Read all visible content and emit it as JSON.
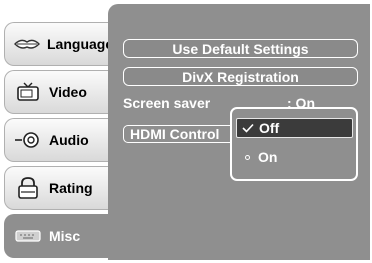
{
  "sidebar": {
    "tabs": [
      {
        "label": "Language",
        "icon": "lips-icon"
      },
      {
        "label": "Video",
        "icon": "tv-icon"
      },
      {
        "label": "Audio",
        "icon": "speaker-icon"
      },
      {
        "label": "Rating",
        "icon": "lock-icon"
      },
      {
        "label": "Misc",
        "icon": "keyboard-icon",
        "active": true
      }
    ]
  },
  "main": {
    "buttons": {
      "default_settings": "Use Default Settings",
      "divx_registration": "DivX Registration"
    },
    "screen_saver": {
      "label": "Screen saver",
      "value": ": On"
    },
    "hdmi_control": {
      "label": "HDMI Control"
    },
    "dropdown": {
      "options": [
        {
          "label": "Off",
          "selected": true
        },
        {
          "label": "On",
          "selected": false
        }
      ]
    }
  },
  "colors": {
    "panel": "#8f8f8f",
    "selected_option": "#3b3b3b",
    "text": "#ffffff"
  }
}
